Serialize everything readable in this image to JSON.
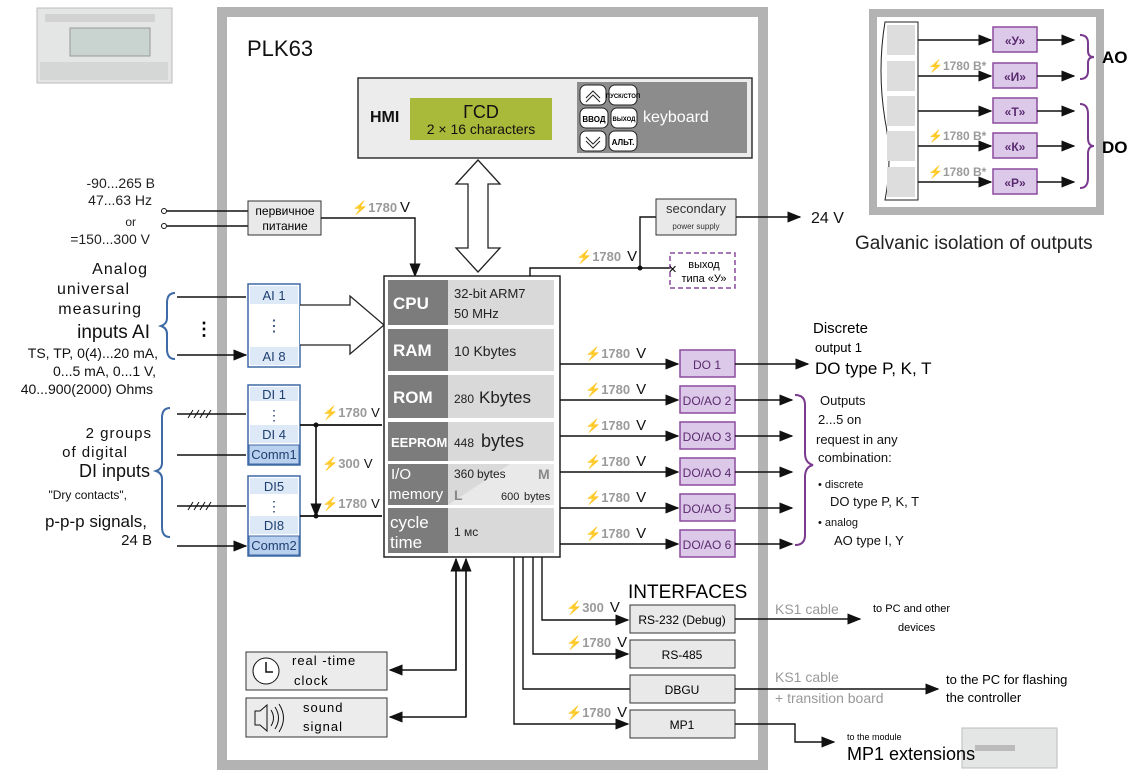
{
  "title": "PLK63",
  "colors": {
    "frame": "#b3b3b3",
    "lcd": "#a9ba3a",
    "keyboard": "#8c8c8c",
    "cpu_label": "#7c7c7c",
    "cpu_value": "#d9d9d9",
    "input_border": "#3e6aa6",
    "input_fill": "#dde9f7",
    "comm_fill": "#b9d0ee",
    "output_border": "#8b4c9e",
    "output_fill": "#dcc8e9",
    "box_fill": "#e9e9e9"
  },
  "hmi": {
    "label": "HMI",
    "lcd_title": "ГCD",
    "lcd_sub": "2 × 16 characters",
    "keys": [
      "ПУСК/СТОП",
      "ВВОД",
      "ВЫХОД",
      "АЛЬТ."
    ],
    "keyboard": "keyboard",
    "icons": [
      "chevron-up-icon",
      "chevron-down-icon"
    ]
  },
  "power": {
    "input_lines": [
      "-90...265 В",
      "47...63 Hz",
      "or",
      "=150...300 V"
    ],
    "primary": [
      "первичное",
      "питание"
    ],
    "isolation": "1780",
    "unit": "V",
    "secondary": [
      "secondary",
      "power supply"
    ],
    "out_24": "24 V",
    "y_output": [
      "выход",
      "типа «У»"
    ],
    "sec_isolation": "1780"
  },
  "analog_inputs": {
    "desc": [
      "Analog",
      "universal",
      "measuring",
      "inputs AI"
    ],
    "types": [
      "TS, TP, 0(4)...20 mA,",
      "0...5 mA, 0...1 V,",
      "40...900(2000) Ohms"
    ],
    "first": "AI 1",
    "last": "AI 8",
    "dots": "⋮"
  },
  "digital_inputs": {
    "desc": [
      "2 groups",
      "of digital",
      "DI inputs"
    ],
    "types": [
      "\"Dry contacts\",",
      "p-p-p signals,",
      "24 В"
    ],
    "g1": [
      "DI 1",
      "DI 4",
      "Comm1"
    ],
    "g2": [
      "DI5",
      "DI8",
      "Comm2"
    ],
    "iso1": "1780",
    "iso_mid": "300",
    "iso2": "1780",
    "unit": "V"
  },
  "cpu": {
    "rows": [
      {
        "label": "CPU",
        "value": "32-bit ARM7",
        "value2": "50 MHz"
      },
      {
        "label": "RAM",
        "value": "10 Kbytes"
      },
      {
        "label": "ROM",
        "value_num": "280",
        "value": "Kbytes"
      },
      {
        "label": "EEPROM",
        "value_num": "448",
        "value": "bytes"
      },
      {
        "label": "I/O",
        "label2": "memory",
        "m_num": "360",
        "m_unit": "bytes",
        "m": "M",
        "l": "L",
        "l_num": "600",
        "l_unit": "bytes"
      },
      {
        "label": "cycle",
        "label2": "time",
        "value": "1 мс"
      }
    ]
  },
  "outputs": {
    "items": [
      "DO 1",
      "DO/AO 2",
      "DO/AO 3",
      "DO/AO 4",
      "DO/AO 5",
      "DO/AO 6"
    ],
    "isolation": "1780",
    "unit": "V",
    "do1_desc": [
      "Discrete",
      "output 1",
      "DO type P, K, T"
    ],
    "others_desc": [
      "Outputs",
      "2...5 on",
      "request in any",
      "combination:",
      "• discrete",
      "DO type P, K, T",
      "• analog",
      "AO type I, Y"
    ]
  },
  "interfaces": {
    "title": "INTERFACES",
    "items": [
      {
        "name": "RS-232 (Debug)",
        "iso": "300",
        "unit": "V"
      },
      {
        "name": "RS-485",
        "iso": "1780",
        "unit": "V"
      },
      {
        "name": "DBGU"
      },
      {
        "name": "MP1",
        "iso": "1780",
        "unit": "V"
      }
    ],
    "rs232_cable": "KS1 cable",
    "rs232_dest": [
      "to PC and other",
      "devices"
    ],
    "dbgu_cable": [
      "KS1 cable",
      "+ transition board"
    ],
    "dbgu_dest": [
      "to the PC for flashing",
      "the controller"
    ],
    "mp1_dest": [
      "to the module",
      "MP1 extensions"
    ]
  },
  "peripherals": {
    "clock": [
      "real -time",
      "clock"
    ],
    "sound": [
      "sound",
      "signal"
    ]
  },
  "galvanic": {
    "outputs": [
      "«У»",
      "«И»",
      "«Т»",
      "«К»",
      "«Р»"
    ],
    "iso": "1780 В*",
    "ao": "AO",
    "do": "DO",
    "caption": "Galvanic isolation of outputs"
  }
}
